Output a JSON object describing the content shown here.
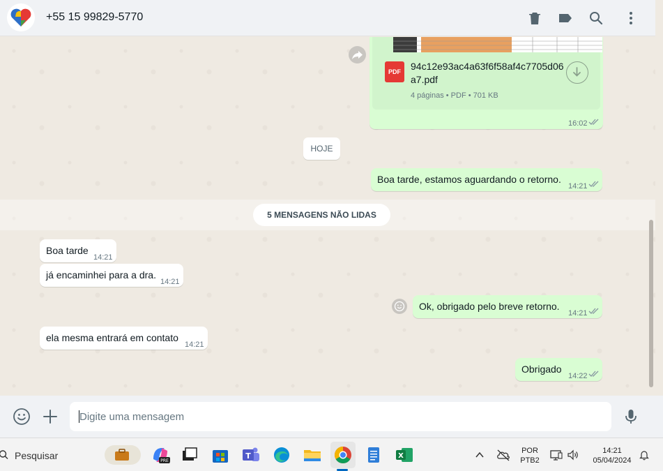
{
  "header": {
    "contact_name": "+55 15 99829-5770",
    "icons": [
      "trash-icon",
      "label-icon",
      "search-icon",
      "menu-icon"
    ]
  },
  "messages": {
    "document": {
      "file_name": "94c12e93ac4a63f6f58af4c7705d06a7.pdf",
      "meta": "4 páginas • PDF • 701 KB",
      "file_type": "PDF",
      "time": "16:02"
    },
    "date_divider": "HOJE",
    "out_1": {
      "text": "Boa tarde, estamos aguardando o retorno.",
      "time": "14:21"
    },
    "unread_divider": "5 MENSAGENS NÃO LIDAS",
    "in_1": {
      "text": "Boa tarde",
      "time": "14:21"
    },
    "in_2": {
      "text": "já encaminhei para a dra.",
      "time": "14:21"
    },
    "out_2": {
      "text": "Ok, obrigado pelo breve retorno.",
      "time": "14:21"
    },
    "in_3": {
      "text": "ela mesma entrará em contato",
      "time": "14:21"
    },
    "out_3": {
      "text": "Obrigado",
      "time": "14:22"
    }
  },
  "composer": {
    "placeholder": "Digite uma mensagem"
  },
  "taskbar": {
    "search_placeholder": "Pesquisar",
    "lang_line1": "POR",
    "lang_line2": "PTB2",
    "clock_time": "14:21",
    "clock_date": "05/04/2024"
  },
  "colors": {
    "outgoing_bubble": "#d9fdd3",
    "incoming_bubble": "#ffffff",
    "chat_background": "#efeae2",
    "read_ticks": "#53bdeb"
  }
}
